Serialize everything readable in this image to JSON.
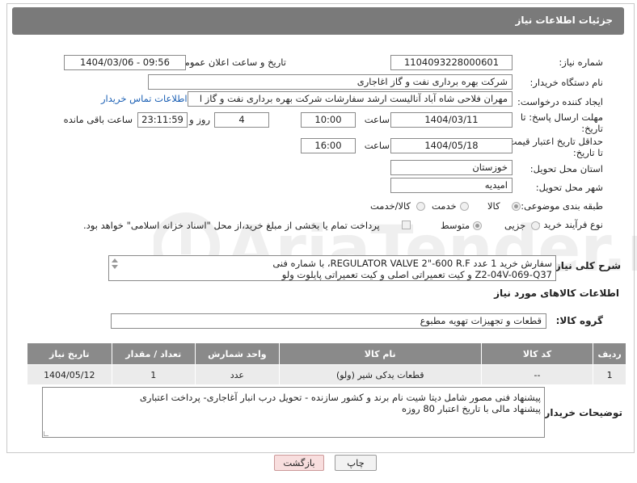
{
  "header": {
    "title": "جزئیات اطلاعات نیاز"
  },
  "fields": {
    "need_number": {
      "label": "شماره نیاز:",
      "value": "1104093228000601"
    },
    "announce_datetime": {
      "label": "تاریخ و ساعت اعلان عمومی:",
      "value": "1404/03/06 - 09:56"
    },
    "buyer_org": {
      "label": "نام دستگاه خریدار:",
      "value": "شرکت بهره برداری نفت و گاز اغاجاری"
    },
    "requester": {
      "label": "ایجاد کننده درخواست:",
      "value": "مهران فلاحی شاه آباد آنالیست ارشد سفارشات شرکت بهره برداری نفت و گاز ا",
      "contact_link": "اطلاعات تماس خریدار"
    },
    "reply_deadline": {
      "label_line1": "مهلت ارسال پاسخ: تا",
      "label_line2": "تاریخ:",
      "date": "1404/03/11",
      "time_label": "ساعت",
      "time": "10:00",
      "days": "4",
      "days_label": "روز و",
      "remaining": "23:11:59",
      "remaining_label": "ساعت باقی مانده"
    },
    "price_validity": {
      "label_line1": "حداقل تاریخ اعتبار قیمت:",
      "label_line2": "تا تاریخ:",
      "date": "1404/05/18",
      "time_label": "ساعت",
      "time": "16:00"
    },
    "province": {
      "label": "استان محل تحویل:",
      "value": "خوزستان"
    },
    "city": {
      "label": "شهر محل تحویل:",
      "value": "امیدیه"
    },
    "category": {
      "label": "طبقه بندی موضوعی:",
      "options": [
        "کالا",
        "خدمت",
        "کالا/خدمت"
      ],
      "selected": "کالا"
    },
    "process_type": {
      "label": "نوع فرآیند خرید :",
      "options": [
        "جزیی",
        "متوسط"
      ],
      "selected": "متوسط",
      "payment_note": "پرداخت تمام یا بخشی از مبلغ خرید،از محل \"اسناد خزانه اسلامی\" خواهد بود."
    },
    "description": {
      "label": "شرح کلی نیاز:",
      "line1": "سفارش خرید 1 عدد REGULATOR VALVE 2\"-600 R.F، با شماره فنی",
      "line2": "Z2-04V-069-Q37   و کیت تعمیراتی اصلی و کیت تعمیراتی پایلوت ولو"
    }
  },
  "goods_section": {
    "title": "اطلاعات کالاهای مورد نیاز",
    "group_label": "گروه کالا:",
    "group_value": "قطعات و تجهیزات تهویه مطبوع"
  },
  "table": {
    "headers": [
      "ردیف",
      "کد کالا",
      "نام کالا",
      "واحد شمارش",
      "تعداد / مقدار",
      "تاریخ نیاز"
    ],
    "rows": [
      [
        "1",
        "--",
        "قطعات یدکی شیر (ولو)",
        "عدد",
        "1",
        "1404/05/12"
      ]
    ]
  },
  "buyer_notes": {
    "label": "توضیحات خریدار:",
    "line1": "پیشنهاد فنی مصور شامل دیتا شیت نام برند و کشور سازنده - تحویل درب انبار آغاجاری- پرداخت اعتباری",
    "line2": "پیشنهاد مالی با تاریخ اعتبار 80 روزه"
  },
  "buttons": {
    "print": "چاپ",
    "back": "بازگشت"
  },
  "watermark": "AriaTender.neT"
}
